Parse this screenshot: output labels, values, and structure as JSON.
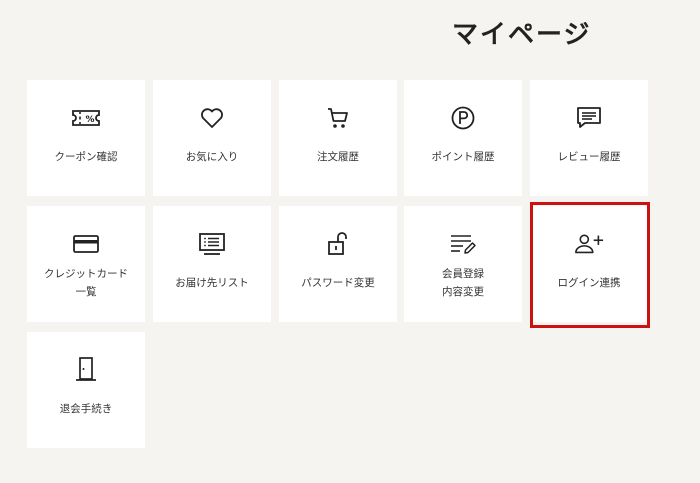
{
  "page": {
    "title": "マイページ"
  },
  "menu": [
    {
      "label": "クーポン確認",
      "icon": "coupon-icon"
    },
    {
      "label": "お気に入り",
      "icon": "heart-icon"
    },
    {
      "label": "注文履歴",
      "icon": "cart-icon"
    },
    {
      "label": "ポイント履歴",
      "icon": "point-icon"
    },
    {
      "label": "レビュー履歴",
      "icon": "review-icon"
    },
    {
      "label": "クレジットカード\n一覧",
      "icon": "credit-card-icon"
    },
    {
      "label": "お届け先リスト",
      "icon": "address-list-icon"
    },
    {
      "label": "パスワード変更",
      "icon": "unlock-icon"
    },
    {
      "label": "会員登録\n内容変更",
      "icon": "edit-profile-icon"
    },
    {
      "label": "ログイン連携",
      "icon": "add-user-icon"
    },
    {
      "label": "退会手続き",
      "icon": "exit-door-icon"
    }
  ],
  "highlight_color": "#cc1111"
}
